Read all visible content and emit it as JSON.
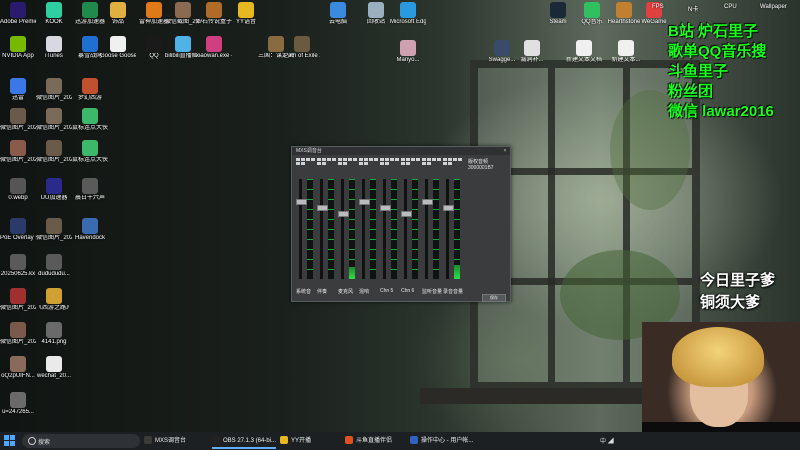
{
  "desktop": {
    "icons": [
      {
        "label": "Adobe Premie...",
        "icon": "premiere-icon",
        "color": "#2a1b6e"
      },
      {
        "label": "KOOK",
        "icon": "kook-icon",
        "color": "#2fd0a0"
      },
      {
        "label": "迅游加速器",
        "icon": "xunyou-icon",
        "color": "#1f8a4c"
      },
      {
        "label": "饰品",
        "icon": "folder-icon",
        "color": "#e0b040"
      },
      {
        "label": "雷神加速器",
        "icon": "leishen-icon",
        "color": "#e07a18"
      },
      {
        "label": "微信截图_2024071...",
        "icon": "image-icon",
        "color": "#8a6a50"
      },
      {
        "label": "炉石传说盒子",
        "icon": "hearthstone-box-icon",
        "color": "#b06a2a"
      },
      {
        "label": "YY语音",
        "icon": "yy-icon",
        "color": "#e8b820"
      },
      {
        "label": "NVIDIA App",
        "icon": "nvidia-icon",
        "color": "#76b900"
      },
      {
        "label": "iTunes",
        "icon": "itunes-icon",
        "color": "#d8d8e0"
      },
      {
        "label": "暴雪战网",
        "icon": "battlenet-icon",
        "color": "#1f6fd0"
      },
      {
        "label": "Goose Goose Duck",
        "icon": "goose-icon",
        "color": "#f0f0f0"
      },
      {
        "label": "QQ",
        "icon": "qq-icon",
        "color": "#1a1a1a"
      },
      {
        "label": "bilibili直播姬 - 快捷方式",
        "icon": "bilibili-icon",
        "color": "#4fb3e8"
      },
      {
        "label": "xiaowan.exe - 快捷方式",
        "icon": "xiaowan-icon",
        "color": "#d04080"
      },
      {
        "label": "三国：谋定天下",
        "icon": "sanguo-icon",
        "color": "#8a6a40"
      },
      {
        "label": "Path of Exile 2",
        "icon": "poe-icon",
        "color": "#6a5a40"
      },
      {
        "label": "迅雷",
        "icon": "xunlei-icon",
        "color": "#3b78e7"
      },
      {
        "label": "微信图片_2025072...",
        "icon": "image-icon",
        "color": "#7a6a5a"
      },
      {
        "label": "梦幻西游",
        "icon": "menghuan-icon",
        "color": "#c05030"
      },
      {
        "label": "微信图片_2025072...",
        "icon": "image-icon",
        "color": "#6a5a4a"
      },
      {
        "label": "微信图片_2025072...",
        "icon": "image-icon",
        "color": "#7a6a5a"
      },
      {
        "label": "鼠标连点大侠",
        "icon": "mouse-clicker-icon",
        "color": "#3cb86a"
      },
      {
        "label": "微信图片_2025072...",
        "icon": "image-icon",
        "color": "#8a5a4a"
      },
      {
        "label": "微信图片_2025072...",
        "icon": "image-icon",
        "color": "#6a5a4a"
      },
      {
        "label": "鼠标连点大侠",
        "icon": "mouse-clicker-icon",
        "color": "#3cb86a"
      },
      {
        "label": "0.webp",
        "icon": "image-icon",
        "color": "#555"
      },
      {
        "label": "UU加速器",
        "icon": "uu-icon",
        "color": "#2a2a8a"
      },
      {
        "label": "晨日十六声",
        "icon": "game-icon",
        "color": "#5a5a5a"
      },
      {
        "label": "PoE Overlay II Standal...",
        "icon": "poe-overlay-icon",
        "color": "#2a3a6a"
      },
      {
        "label": "微信图片_2025071...",
        "icon": "image-icon",
        "color": "#6a5a4a"
      },
      {
        "label": "Havendock",
        "icon": "havendock-icon",
        "color": "#3a6ab0"
      },
      {
        "label": "20250625.kx",
        "icon": "file-icon",
        "color": "#5a5a5a"
      },
      {
        "label": "dudududu...",
        "icon": "file-icon",
        "color": "#5a5a5a"
      },
      {
        "label": "微信图片_2025062...",
        "icon": "image-icon",
        "color": "#a03030"
      },
      {
        "label": "《西游之路》Pacman版 - 双光...",
        "icon": "pacman-icon",
        "color": "#d0a030"
      },
      {
        "label": "微信图片_2025091...",
        "icon": "image-icon",
        "color": "#7a5a4a"
      },
      {
        "label": "4141.png",
        "icon": "image-icon",
        "color": "#6a6a6a"
      },
      {
        "label": "oQ2pUIFN...",
        "icon": "image-icon",
        "color": "#8a6a5a"
      },
      {
        "label": "wechat_20...",
        "icon": "image-icon",
        "color": "#eaeaea"
      },
      {
        "label": "u=247265...",
        "icon": "image-icon",
        "color": "#6a6a6a"
      },
      {
        "label": "云电脑",
        "icon": "cloud-pc-icon",
        "color": "#3a8ae0"
      },
      {
        "label": "回收站",
        "icon": "recycle-bin-icon",
        "color": "#9ab0c0"
      },
      {
        "label": "Microsoft Edge",
        "icon": "edge-icon",
        "color": "#2a9ae0"
      },
      {
        "label": "Manyo...",
        "icon": "image-icon",
        "color": "#d0a0b0"
      },
      {
        "label": "Swagge...",
        "icon": "image-icon",
        "color": "#3a4a6a"
      },
      {
        "label": "漏洞补...",
        "icon": "file-icon",
        "color": "#e0e0e0"
      },
      {
        "label": "新建文本文档.txt",
        "icon": "text-file-icon",
        "color": "#f0f0f0"
      },
      {
        "label": "新建文本...",
        "icon": "text-file-icon",
        "color": "#f0f0f0"
      }
    ],
    "tray_icons": [
      {
        "label": "FPS",
        "icon": "fps-icon"
      },
      {
        "label": "N卡",
        "icon": "nvidia-tray-icon"
      },
      {
        "label": "CPU",
        "icon": "cpu-icon"
      },
      {
        "label": "Wallpaper",
        "icon": "wallpaper-icon"
      }
    ],
    "top_row_extra": [
      {
        "label": "Steam",
        "icon": "steam-icon",
        "color": "#1b2838"
      },
      {
        "label": "QQ音乐",
        "icon": "qq-music-icon",
        "color": "#30c060"
      },
      {
        "label": "Hearthstone",
        "icon": "hearthstone-icon",
        "color": "#c08030"
      },
      {
        "label": "WeGame",
        "icon": "wegame-icon",
        "color": "#e04040"
      }
    ]
  },
  "overlay_green": [
    "B站 炉石里子",
    "歌单QQ音乐搜",
    "斗鱼里子",
    "粉丝团",
    "微信  lawar2016"
  ],
  "overlay_white": [
    "今日里子爹",
    "铜须大爹"
  ],
  "mixer": {
    "title": "MXS调音台",
    "close": "×",
    "channels": [
      {
        "label": "系统音",
        "level": 0.0
      },
      {
        "label": "伴奏",
        "level": 0.0
      },
      {
        "label": "麦克风",
        "level": 0.12
      },
      {
        "label": "混响",
        "level": 0.0
      },
      {
        "label": "Chn 5",
        "level": 0.0
      },
      {
        "label": "Chn 6",
        "level": 0.0
      },
      {
        "label": "监听音量",
        "level": 0.0
      },
      {
        "label": "录音音量",
        "level": 0.14
      }
    ],
    "info_lines": [
      "版权音频",
      "3000001B7"
    ],
    "button": "保存"
  },
  "taskbar": {
    "search_placeholder": "搜索",
    "apps": [
      {
        "label": "MXS调音台",
        "icon": "mixer-app-icon",
        "color": "#3a3a3a",
        "active": false
      },
      {
        "label": "OBS 27.1.3 (64-bi...",
        "icon": "obs-icon",
        "color": "#222",
        "active": true
      },
      {
        "label": "YY开播",
        "icon": "yy-live-icon",
        "color": "#e8b820",
        "active": false
      },
      {
        "label": "斗鱼直播伴侣",
        "icon": "douyu-icon",
        "color": "#e05020",
        "active": false
      },
      {
        "label": "操作中心 - 用户帐...",
        "icon": "action-center-icon",
        "color": "#3060c0",
        "active": false
      }
    ],
    "tray_text": "中  ◢"
  }
}
